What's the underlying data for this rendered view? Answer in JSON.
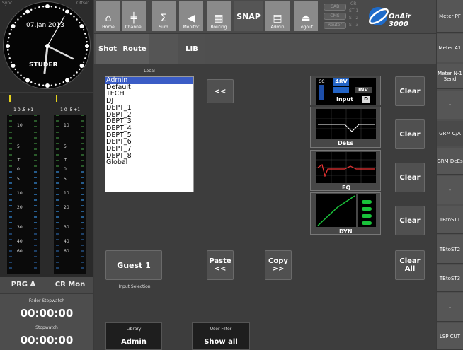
{
  "clock": {
    "sync": "Sync",
    "offset": "Offset",
    "date": "07.Jan.2013",
    "brand": "STUDER"
  },
  "meters": {
    "scale_a": "-1  0  .5  +1",
    "scale_b": "-1  0  .5  +1",
    "ticks": [
      "10",
      "5",
      "+",
      "0",
      "5",
      "10",
      "20",
      "30",
      "40",
      "60"
    ],
    "names": [
      "PRG A",
      "CR Mon"
    ]
  },
  "stopwatch": {
    "fader_label": "Fader Stopwatch",
    "fader_time": "00:00:00",
    "label": "Stopwatch",
    "time": "00:00:00"
  },
  "toolbar": {
    "buttons": [
      {
        "label": "Home",
        "icon": "home-icon"
      },
      {
        "label": "Channel",
        "icon": "channel-icon"
      },
      {
        "label": "Sum",
        "icon": "sum-icon"
      },
      {
        "label": "Monitor",
        "icon": "speaker-icon"
      },
      {
        "label": "Routing",
        "icon": "grid-icon"
      }
    ],
    "snap": "SNAP",
    "admin": "Admin",
    "logout": "Logout",
    "cab": "CAB",
    "cms": "CMS",
    "router": "Router",
    "cr": "CR",
    "st1": "ST 1",
    "st2": "ST 2",
    "st3": "ST 3",
    "brand": "OnAir 3000"
  },
  "subbar": {
    "tabs": [
      "Shot",
      "Route",
      "LIB"
    ]
  },
  "library": {
    "title": "Local",
    "items": [
      "Admin",
      "Default",
      "TECH",
      "DJ",
      "DEPT_1",
      "DEPT_2",
      "DEPT_3",
      "DEPT_4",
      "DEPT_5",
      "DEPT_6",
      "DEPT_7",
      "DEPT_8",
      "Global"
    ],
    "selected": "Admin"
  },
  "buttons": {
    "back": "<<",
    "paste_top": "Paste",
    "paste_bot": "<<",
    "copy_top": "Copy",
    "copy_bot": ">>",
    "guest": "Guest 1",
    "input_selection": "Input Selection",
    "clear": "Clear",
    "clear_all_top": "Clear",
    "clear_all_bot": "All"
  },
  "modules": {
    "input": {
      "cc": "CC",
      "v48": "48V",
      "inv": "INV",
      "label": "Input",
      "d": "D"
    },
    "dees": "DeEs",
    "eq": "EQ",
    "dyn": "DYN"
  },
  "bottom": {
    "library_label": "Library",
    "library_value": "Admin",
    "filter_label": "User Filter",
    "filter_value": "Show all"
  },
  "right": [
    "Meter PF",
    "Meter A1",
    "Meter N-1 Send",
    "-",
    "GRM C/A",
    "GRM DeEs",
    "-",
    "TBtoST1",
    "TBtoST2",
    "TBtoST3",
    "-",
    "LSP CUT"
  ],
  "colors": {
    "accent": "#3a5cc6",
    "meter_green": "#2ea54a",
    "meter_yellow": "#d8c21a",
    "module_green": "#0c9c2c"
  }
}
